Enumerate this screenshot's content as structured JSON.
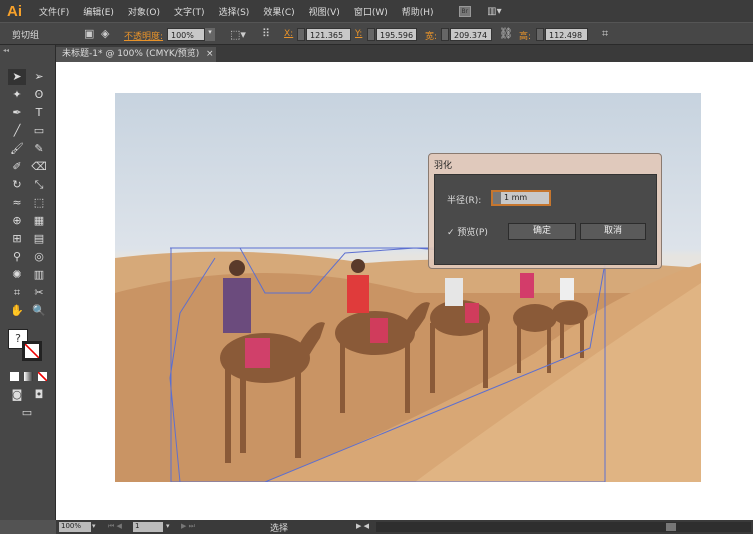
{
  "app": {
    "logo": "Ai"
  },
  "menu": [
    "文件(F)",
    "编辑(E)",
    "对象(O)",
    "文字(T)",
    "选择(S)",
    "效果(C)",
    "视图(V)",
    "窗口(W)",
    "帮助(H)"
  ],
  "menu_icons": {
    "bridge": "Br"
  },
  "control": {
    "selection_type": "剪切组",
    "opacity_label": "不透明度:",
    "opacity_value": "100%",
    "x_label": "X:",
    "x_value": "121.365",
    "y_label": "Y:",
    "y_value": "195.596",
    "w_label": "宽:",
    "w_value": "209.374",
    "h_label": "高:",
    "h_value": "112.498"
  },
  "document_tab": {
    "title": "未标题-1* @ 100% (CMYK/预览)",
    "close": "×"
  },
  "dialog": {
    "title": "羽化",
    "radius_label": "半径(R):",
    "radius_value": "1 mm",
    "preview_label": "预览(P)",
    "preview_checked": true,
    "ok": "确定",
    "cancel": "取消"
  },
  "status": {
    "zoom": "100%",
    "page": "1",
    "tool": "选择"
  },
  "toolbox": {
    "help": "?"
  }
}
